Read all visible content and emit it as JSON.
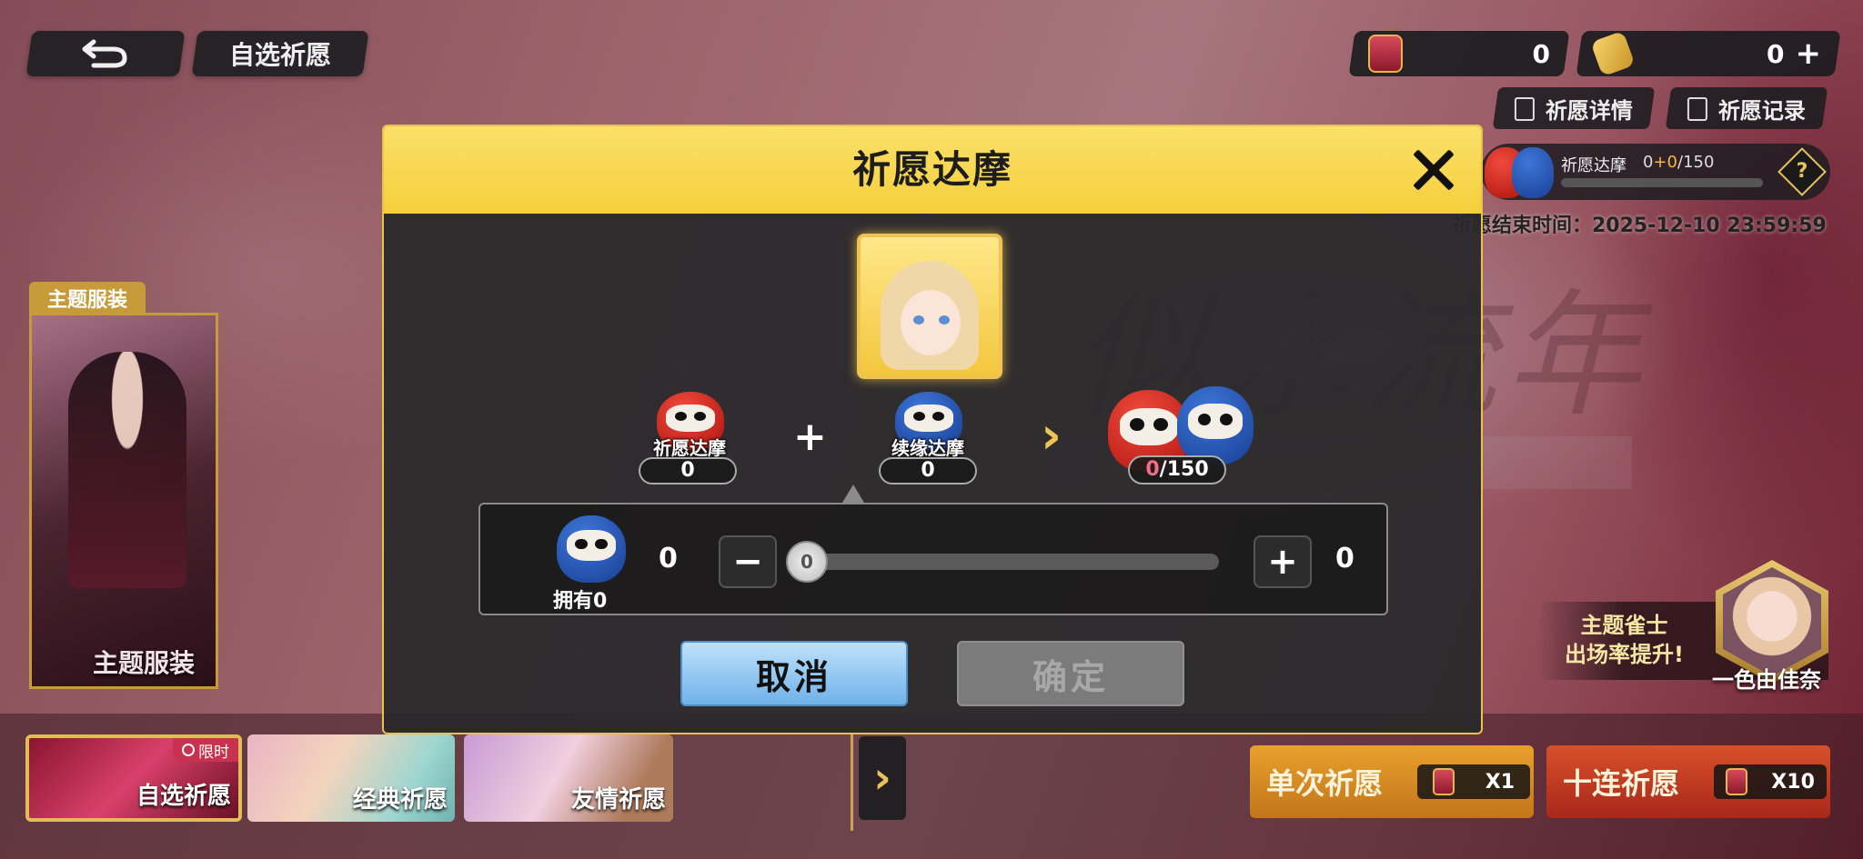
{
  "header": {
    "title": "自选祈愿"
  },
  "currencies": [
    {
      "value": "0"
    },
    {
      "value": "0",
      "plus": "+"
    }
  ],
  "links": {
    "details": "祈愿详情",
    "records": "祈愿记录"
  },
  "daruma_progress": {
    "label": "祈愿达摩",
    "current": "0",
    "added": "+0",
    "total": "/150",
    "fill": 0
  },
  "end_time": "祈愿结束时间：2025-12-10 23:59:59",
  "outfit": {
    "tag": "主题服装",
    "label": "主题服装"
  },
  "feature": {
    "text_line1": "主题雀士",
    "text_line2": "出场率提升!",
    "name": "一色由佳奈"
  },
  "tabs": [
    {
      "label": "自选祈愿",
      "badge": "限时"
    },
    {
      "label": "经典祈愿"
    },
    {
      "label": "友情祈愿"
    }
  ],
  "pray": {
    "single": {
      "label": "单次祈愿",
      "cost": "X1"
    },
    "ten": {
      "label": "十连祈愿",
      "cost": "X10"
    }
  },
  "modal": {
    "title": "祈愿达摩",
    "item_a": {
      "label": "祈愿达摩",
      "count": "0"
    },
    "item_b": {
      "label": "续缘达摩",
      "count": "0"
    },
    "result": {
      "current": "0",
      "total": "/150"
    },
    "slider": {
      "owned": "拥有0",
      "left_value": "0",
      "right_value": "0",
      "thumb_value": "0",
      "minus": "−",
      "plus": "+"
    },
    "cancel": "取消",
    "confirm": "确定"
  },
  "colors": {
    "accent_gold": "#e9c24c",
    "modal_header": "#f5cf3a",
    "cancel_blue": "#6fb2ea"
  }
}
